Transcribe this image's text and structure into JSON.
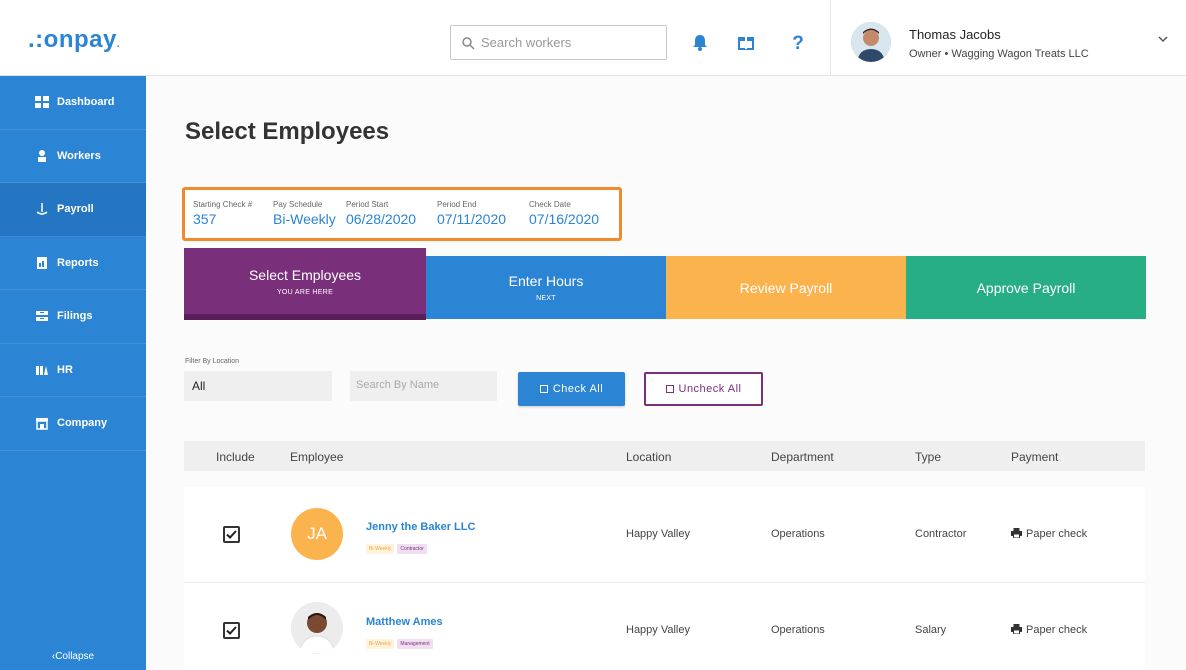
{
  "app": {
    "logo": "onpay",
    "search_placeholder": "Search workers",
    "user": {
      "name": "Thomas Jacobs",
      "role": "Owner • Wagging Wagon Treats LLC"
    }
  },
  "sidebar": {
    "items": [
      {
        "label": "Dashboard",
        "icon": "dashboard-icon"
      },
      {
        "label": "Workers",
        "icon": "workers-icon"
      },
      {
        "label": "Payroll",
        "icon": "payroll-icon",
        "active": true
      },
      {
        "label": "Reports",
        "icon": "reports-icon"
      },
      {
        "label": "Filings",
        "icon": "filings-icon"
      },
      {
        "label": "HR",
        "icon": "hr-icon"
      },
      {
        "label": "Company",
        "icon": "company-icon"
      }
    ],
    "collapse": "‹Collapse"
  },
  "page": {
    "title": "Select Employees",
    "check_info": {
      "starting_check_label": "Starting Check #",
      "starting_check": "357",
      "pay_schedule_label": "Pay Schedule",
      "pay_schedule": "Bi-Weekly",
      "period_start_label": "Period Start",
      "period_start": "06/28/2020",
      "period_end_label": "Period End",
      "period_end": "07/11/2020",
      "check_date_label": "Check Date",
      "check_date": "07/16/2020"
    },
    "steps": [
      {
        "title": "Select Employees",
        "sub": "YOU ARE HERE"
      },
      {
        "title": "Enter Hours",
        "sub": "NEXT"
      },
      {
        "title": "Review Payroll",
        "sub": ""
      },
      {
        "title": "Approve Payroll",
        "sub": ""
      }
    ],
    "filters": {
      "location_label": "Filter By Location",
      "location_value": "All",
      "name_placeholder": "Search By Name",
      "check_all": "Check All",
      "uncheck_all": "Uncheck All"
    },
    "table": {
      "headers": [
        "Include",
        "Employee",
        "Location",
        "Department",
        "Type",
        "Payment"
      ],
      "rows": [
        {
          "checked": true,
          "initials": "JA",
          "name": "Jenny the Baker LLC",
          "tags": [
            "Bi-Weekly",
            "Contractor"
          ],
          "location": "Happy Valley",
          "department": "Operations",
          "type": "Contractor",
          "payment": "Paper check"
        },
        {
          "checked": true,
          "initials": "",
          "name": "Matthew Ames",
          "tags": [
            "Bi-Weekly",
            "Management"
          ],
          "location": "Happy Valley",
          "department": "Operations",
          "type": "Salary",
          "payment": "Paper check"
        }
      ]
    }
  },
  "colors": {
    "brand_blue": "#2b84d4",
    "purple": "#7a2f7a",
    "orange": "#fbb34e",
    "green": "#27ae84",
    "highlight": "#f08a2c"
  }
}
